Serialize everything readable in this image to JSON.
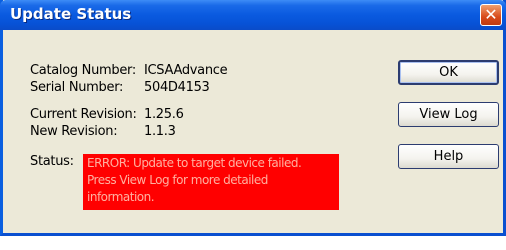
{
  "window": {
    "title": "Update Status",
    "close_glyph": "✕"
  },
  "fields": {
    "catalog_label": "Catalog Number:",
    "catalog_value": "ICSAAdvance",
    "serial_label": "Serial Number:",
    "serial_value": "504D4153",
    "current_rev_label": "Current Revision:",
    "current_rev_value": "1.25.6",
    "new_rev_label": "New Revision:",
    "new_rev_value": "1.1.3",
    "status_label": "Status:",
    "status_message": "ERROR: Update to target device failed.\nPress View Log for more detailed\ninformation."
  },
  "buttons": {
    "ok": "OK",
    "view_log": "View Log",
    "help": "Help"
  },
  "colors": {
    "titlebar": "#0a5ae0",
    "dialog_bg": "#ece9d8",
    "error_bg": "#ff0000",
    "close_button": "#d84a1a"
  }
}
